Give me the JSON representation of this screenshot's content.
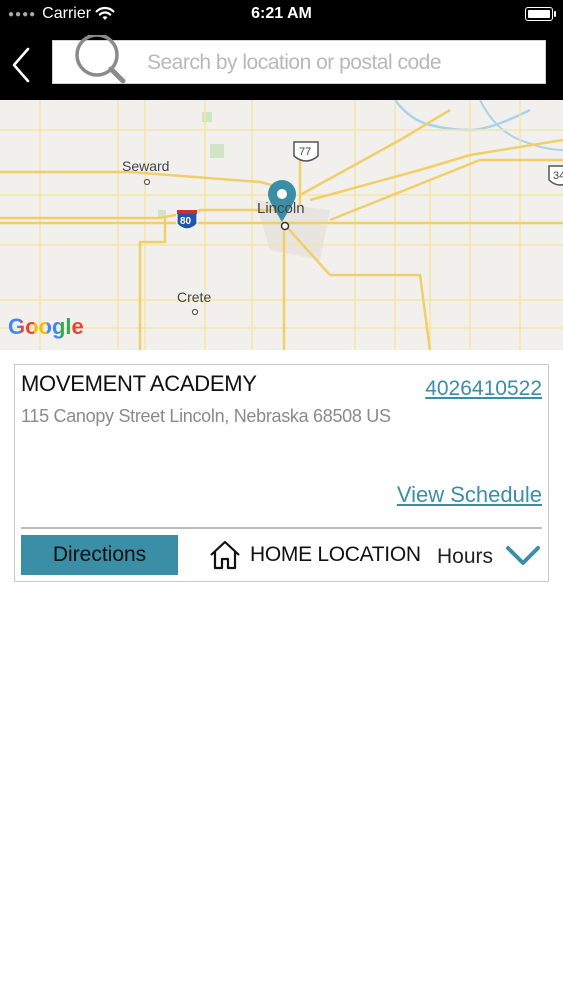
{
  "status_bar": {
    "carrier": "Carrier",
    "time": "6:21 AM"
  },
  "search": {
    "placeholder": "Search by location or postal code",
    "value": ""
  },
  "map": {
    "labels": {
      "seward": "Seward",
      "lincoln": "Lincoln",
      "crete": "Crete",
      "highway_77": "77",
      "interstate_80": "80",
      "highway_34": "34"
    },
    "attribution": "Google",
    "pin_color": "#3a8ea6"
  },
  "location": {
    "name": "MOVEMENT ACADEMY",
    "phone": "4026410522",
    "address": "115 Canopy Street Lincoln, Nebraska 68508 US",
    "view_schedule": "View Schedule",
    "directions": "Directions",
    "home_location": "HOME LOCATION",
    "hours": "Hours"
  },
  "colors": {
    "accent": "#3a8ea6",
    "nav_background": "#000000"
  }
}
